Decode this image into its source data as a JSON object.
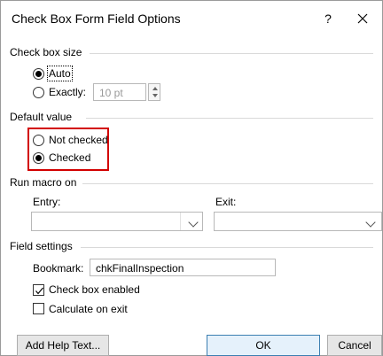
{
  "dialog": {
    "title": "Check Box Form Field Options",
    "help": "?"
  },
  "check_box_size": {
    "title": "Check box size",
    "auto_label": "Auto",
    "exactly_label": "Exactly:",
    "exactly_value": "10 pt",
    "selected": "Auto"
  },
  "default_value": {
    "title": "Default value",
    "not_checked_label": "Not checked",
    "checked_label": "Checked",
    "selected": "Checked"
  },
  "run_macro_on": {
    "title": "Run macro on",
    "entry_label": "Entry:",
    "exit_label": "Exit:",
    "entry_value": "",
    "exit_value": ""
  },
  "field_settings": {
    "title": "Field settings",
    "bookmark_label": "Bookmark:",
    "bookmark_value": "chkFinalInspection",
    "enabled_label": "Check box enabled",
    "enabled_checked": true,
    "calc_label": "Calculate on exit",
    "calc_checked": false
  },
  "buttons": {
    "add_help": "Add Help Text...",
    "ok": "OK",
    "cancel": "Cancel"
  },
  "colors": {
    "highlight_border": "#d20000",
    "primary_button_border": "#3c7fb1"
  },
  "icons": [
    "close-icon",
    "radio-icon",
    "checkbox-check-icon",
    "chevron-down-icon",
    "spinner-up-icon",
    "spinner-down-icon"
  ]
}
